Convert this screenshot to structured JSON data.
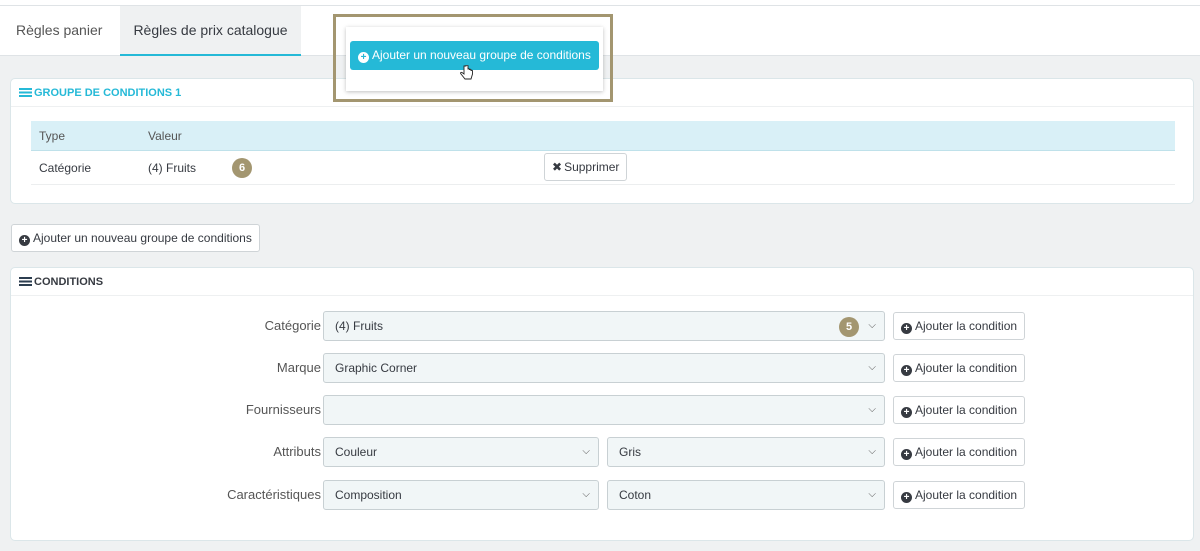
{
  "tabs": [
    {
      "label": "Règles panier"
    },
    {
      "label": "Règles de prix catalogue"
    }
  ],
  "callout": {
    "button_label": "Ajouter un nouveau groupe de conditions"
  },
  "condition_group": {
    "title": "GROUPE DE CONDITIONS 1",
    "columns": [
      "Type",
      "Valeur"
    ],
    "rows": [
      {
        "type": "Catégorie",
        "value": "(4) Fruits",
        "badge": "6",
        "delete_label": "Supprimer"
      }
    ]
  },
  "add_group_button": "Ajouter un nouveau groupe de conditions",
  "conditions": {
    "title": "CONDITIONS",
    "add_label": "Ajouter la condition",
    "rows": [
      {
        "label": "Catégorie",
        "value": "(4) Fruits",
        "badge": "5"
      },
      {
        "label": "Marque",
        "value": "Graphic Corner"
      },
      {
        "label": "Fournisseurs",
        "value": ""
      },
      {
        "label": "Attributs",
        "value": "Couleur",
        "value2": "Gris"
      },
      {
        "label": "Caractéristiques",
        "value": "Composition",
        "value2": "Coton"
      }
    ]
  },
  "colors": {
    "accent": "#25b9d7",
    "badge": "#a39670",
    "table_header": "#d9f0f7"
  }
}
